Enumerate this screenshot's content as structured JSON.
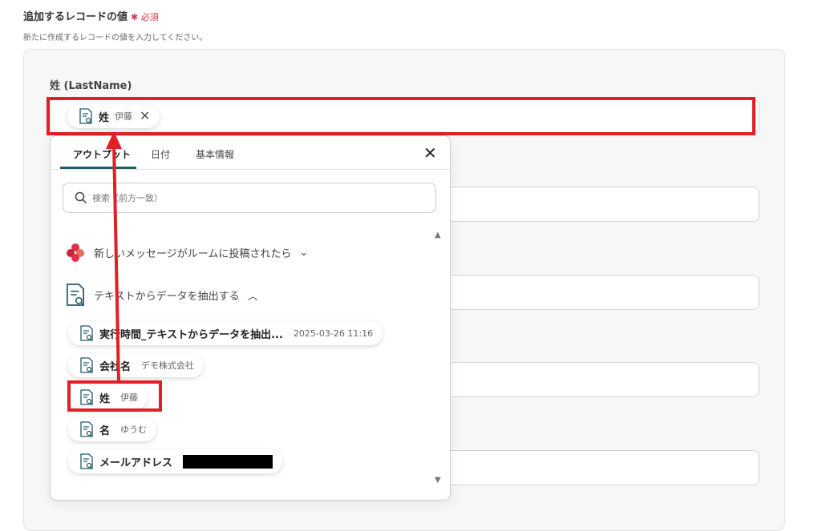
{
  "section": {
    "title": "追加するレコードの値",
    "required": "✱ 必須",
    "description": "新たに作成するレコードの値を入力してください。"
  },
  "field": {
    "label": "姓 (LastName)",
    "chip": {
      "name": "姓",
      "value": "伊藤",
      "close": "✕"
    }
  },
  "dropdown": {
    "tabs": [
      "アウトプット",
      "日付",
      "基本情報"
    ],
    "close": "✕",
    "search_placeholder": "検索（前方一致）",
    "groups": [
      {
        "title": "新しいメッセージがルームに投稿されたら",
        "chevron": "⌄"
      },
      {
        "title": "テキストからデータを抽出する",
        "chevron": "︿"
      }
    ],
    "items": [
      {
        "name": "実行時間_テキストからデータを抽出...",
        "value": "2025-03-26 11:16"
      },
      {
        "name": "会社名",
        "value": "デモ株式会社"
      },
      {
        "name": "姓",
        "value": "伊藤"
      },
      {
        "name": "名",
        "value": "ゆうむ"
      },
      {
        "name": "メールアドレス",
        "value": ""
      }
    ],
    "scroll_up": "▲",
    "scroll_down": "▼"
  },
  "colors": {
    "highlight": "#e01f26",
    "accent": "#1f5b6b",
    "required": "#e0324b"
  }
}
